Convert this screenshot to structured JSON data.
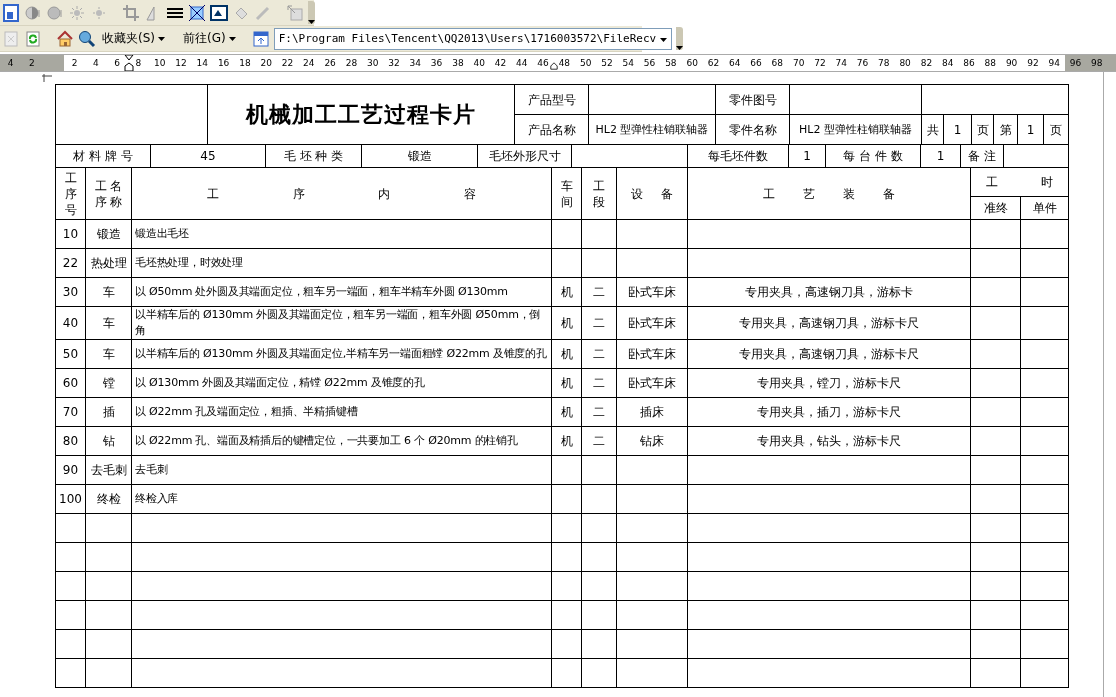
{
  "toolbar": {
    "favorites": "收藏夹(S)",
    "go": "前往(G)",
    "address": "F:\\Program Files\\Tencent\\QQ2013\\Users\\1716003572\\FileRecv"
  },
  "ruler": {
    "left_labels": [
      "4",
      "2"
    ],
    "labels": [
      "2",
      "4",
      "6",
      "8",
      "10",
      "12",
      "14",
      "16",
      "18",
      "20",
      "22",
      "24",
      "26",
      "28",
      "30",
      "32",
      "34",
      "36",
      "38",
      "40",
      "42",
      "44",
      "46",
      "48",
      "50",
      "52",
      "54",
      "56",
      "58",
      "60",
      "62",
      "64",
      "66",
      "68",
      "70",
      "72",
      "74",
      "76",
      "78",
      "80",
      "82",
      "84",
      "86",
      "88",
      "90",
      "92",
      "94"
    ],
    "right_labels": [
      "96",
      "98"
    ]
  },
  "card": {
    "title": "机械加工工艺过程卡片",
    "product_model_label": "产品型号",
    "part_drawing_label": "零件图号",
    "product_name_label": "产品名称",
    "product_name": "HL2 型弹性柱销联轴器",
    "part_name_label": "零件名称",
    "part_name": "HL2 型弹性柱销联轴器",
    "total_label": "共",
    "total_pages": "1",
    "total_unit": "页",
    "page_label": "第",
    "page_no": "1",
    "page_unit": "页"
  },
  "material": {
    "grade_label": "材 料 牌 号",
    "grade": "45",
    "blank_type_label": "毛 坯 种 类",
    "blank_type": "锻造",
    "blank_size_label": "毛坯外形尺寸",
    "per_blank_label": "每毛坯件数",
    "per_blank": "1",
    "per_unit_label": "每 台 件 数",
    "per_unit": "1",
    "remarks_label": "备 注"
  },
  "columns": {
    "no": [
      "工",
      "序",
      "号"
    ],
    "name": [
      "工 名",
      "序 称"
    ],
    "content": "工 序 内 容",
    "workshop": [
      "车",
      "间"
    ],
    "section": [
      "工",
      "段"
    ],
    "equipment": "设 备",
    "tooling": "工 艺 装 备",
    "hours": "工 时",
    "prep": "准终",
    "unit": "单件"
  },
  "rows": [
    {
      "no": "10",
      "name": "锻造",
      "content": "锻造出毛坯"
    },
    {
      "no": "22",
      "name": "热处理",
      "content": "毛坯热处理，时效处理"
    },
    {
      "no": "30",
      "name": "车",
      "content": "以 Ø50mm 处外圆及其端面定位，粗车另一端面，粗车半精车外圆 Ø130mm",
      "workshop": "机",
      "section": "二",
      "equipment": "卧式车床",
      "tooling": "专用夹具，高速钢刀具，游标卡"
    },
    {
      "no": "40",
      "name": "车",
      "content": "以半精车后的 Ø130mm 外圆及其端面定位，粗车另一端面，粗车外圆 Ø50mm，倒角",
      "workshop": "机",
      "section": "二",
      "equipment": "卧式车床",
      "tooling": "专用夹具，高速钢刀具，游标卡尺"
    },
    {
      "no": "50",
      "name": "车",
      "content": "以半精车后的 Ø130mm 外圆及其端面定位,半精车另一端面粗镗 Ø22mm 及锥度的孔",
      "workshop": "机",
      "section": "二",
      "equipment": "卧式车床",
      "tooling": "专用夹具，高速钢刀具，游标卡尺"
    },
    {
      "no": "60",
      "name": "镗",
      "content": "以 Ø130mm 外圆及其端面定位，精镗 Ø22mm 及锥度的孔",
      "workshop": "机",
      "section": "二",
      "equipment": "卧式车床",
      "tooling": "专用夹具，镗刀，游标卡尺"
    },
    {
      "no": "70",
      "name": "插",
      "content": "以 Ø22mm 孔及端面定位，粗插、半精插键槽",
      "workshop": "机",
      "section": "二",
      "equipment": "插床",
      "tooling": "专用夹具，插刀，游标卡尺"
    },
    {
      "no": "80",
      "name": "钻",
      "content": "以 Ø22mm 孔、端面及精插后的键槽定位，一共要加工 6 个 Ø20mm 的柱销孔",
      "workshop": "机",
      "section": "二",
      "equipment": "钻床",
      "tooling": "专用夹具，钻头，游标卡尺"
    },
    {
      "no": "90",
      "name": "去毛刺",
      "content": "去毛刺"
    },
    {
      "no": "100",
      "name": "终检",
      "content": "终检入库"
    },
    {},
    {},
    {},
    {},
    {},
    {}
  ]
}
